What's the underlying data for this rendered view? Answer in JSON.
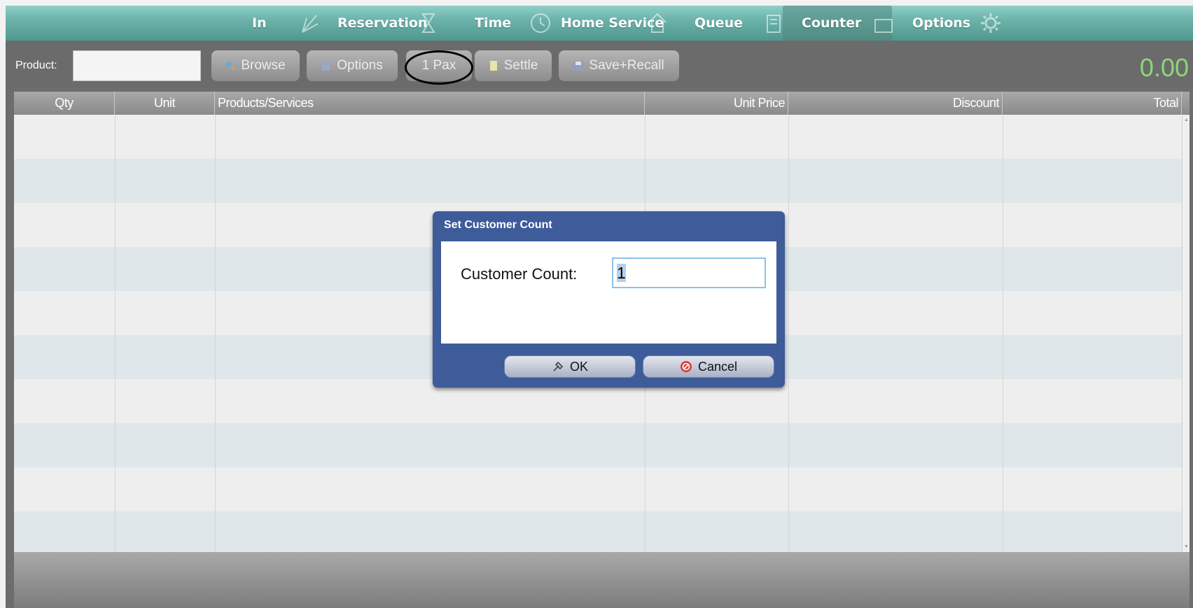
{
  "nav": {
    "tabs": [
      {
        "label": "In",
        "icon": "checkin-icon"
      },
      {
        "label": "Reservation",
        "icon": "hourglass-icon"
      },
      {
        "label": "Time",
        "icon": "clock-icon"
      },
      {
        "label": "Home Service",
        "icon": "house-icon"
      },
      {
        "label": "Queue",
        "icon": "queue-icon"
      },
      {
        "label": "Counter",
        "icon": "counter-icon",
        "active": true
      },
      {
        "label": "Options",
        "icon": "gear-icon"
      }
    ]
  },
  "toolbar": {
    "product_label": "Product:",
    "product_value": "",
    "browse_label": "Browse",
    "options_label": "Options",
    "pax_label": "1 Pax",
    "settle_label": "Settle",
    "save_recall_label": "Save+Recall",
    "total": "0.00"
  },
  "grid": {
    "columns": [
      "Qty",
      "Unit",
      "Products/Services",
      "Unit Price",
      "Discount",
      "Total"
    ],
    "rows": []
  },
  "dialog": {
    "title": "Set Customer Count",
    "field_label": "Customer Count:",
    "field_value": "1",
    "ok_label": "OK",
    "cancel_label": "Cancel"
  },
  "colors": {
    "nav_teal": "#6cb3aa",
    "dialog_blue": "#3e5b9a",
    "total_green": "#8ed67a"
  }
}
